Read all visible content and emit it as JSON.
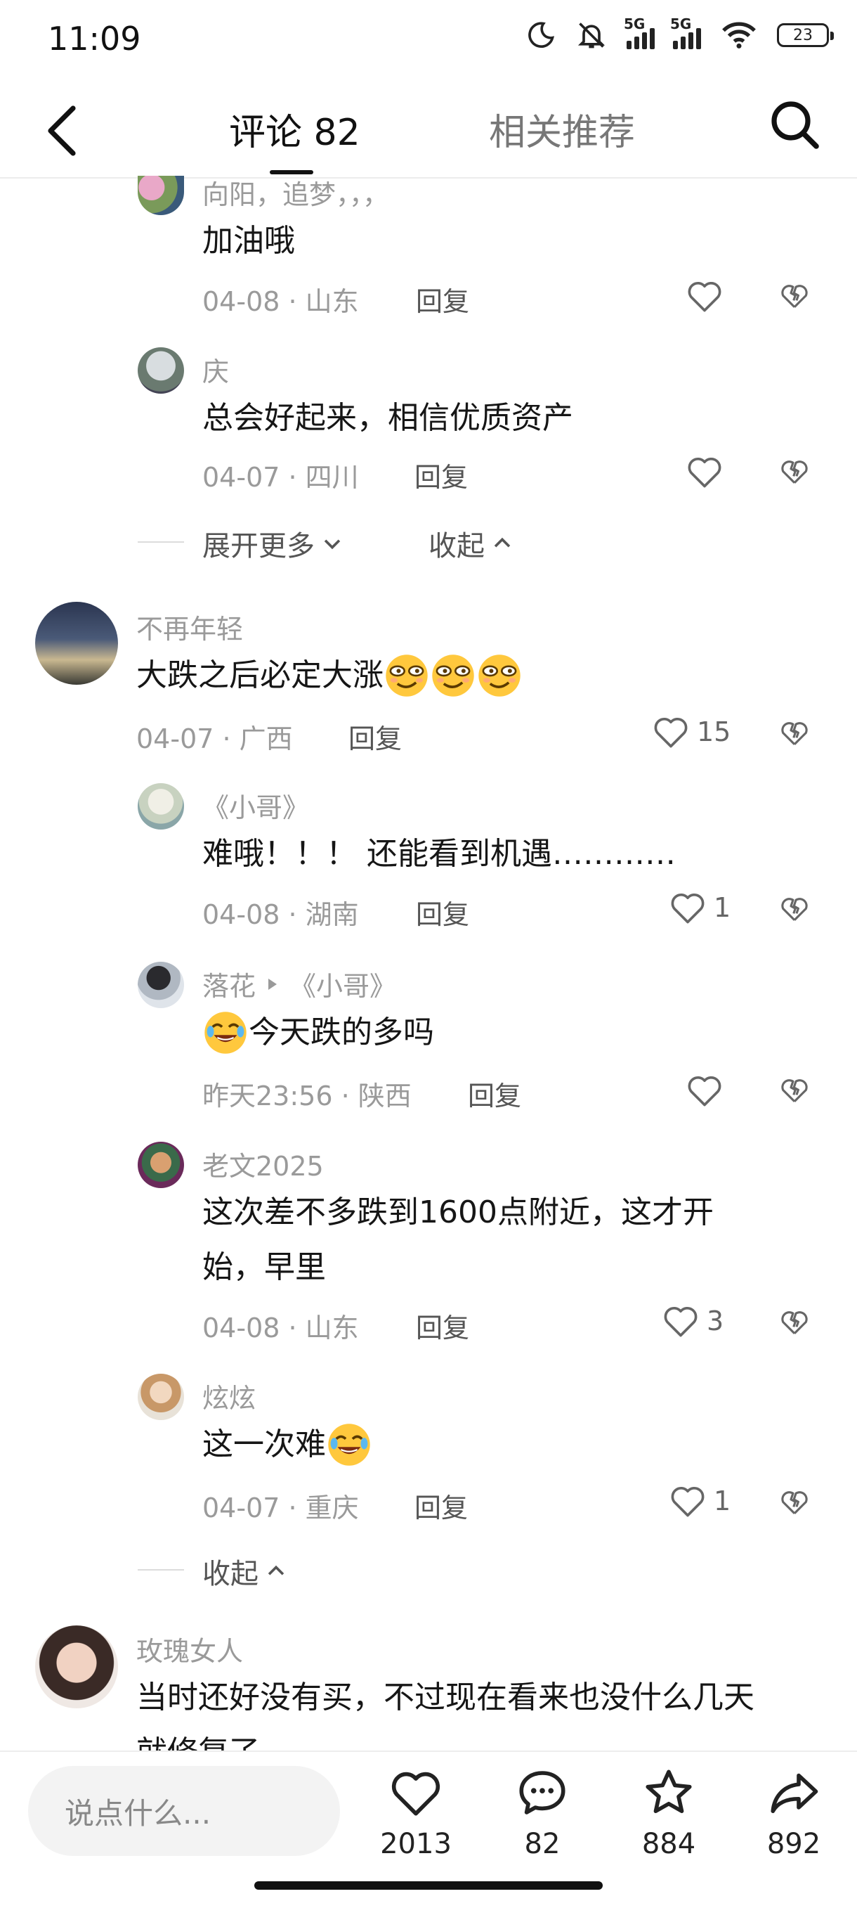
{
  "status_bar": {
    "time": "11:09",
    "battery": "23",
    "network1": "5G",
    "network2": "5G"
  },
  "header": {
    "tab_comments": "评论 82",
    "tab_related": "相关推荐"
  },
  "comments": [
    {
      "name": "向阳，追梦，，，",
      "text": "加油哦",
      "date": "04-08",
      "location": "山东",
      "reply": "回复",
      "likes": ""
    },
    {
      "name": "庆",
      "text": "总会好起来，相信优质资产",
      "date": "04-07",
      "location": "四川",
      "reply": "回复",
      "likes": ""
    },
    {
      "name": "不再年轻",
      "text": "大跌之后必定大涨",
      "date": "04-07",
      "location": "广西",
      "reply": "回复",
      "likes": "15"
    },
    {
      "name": "《小哥》",
      "text": "难哦！！！ 还能看到机遇…………",
      "date": "04-08",
      "location": "湖南",
      "reply": "回复",
      "likes": "1"
    },
    {
      "name": "落花",
      "reply_to": "《小哥》",
      "text": "今天跌的多吗",
      "date": "昨天23:56",
      "location": "陕西",
      "reply": "回复",
      "likes": ""
    },
    {
      "name": "老文2025",
      "text_line1": "这次差不多跌到1600点附近，这才开",
      "text_line2": "始，早里",
      "date": "04-08",
      "location": "山东",
      "reply": "回复",
      "likes": "3"
    },
    {
      "name": "炫炫",
      "text": "这一次难",
      "date": "04-07",
      "location": "重庆",
      "reply": "回复",
      "likes": "1"
    },
    {
      "name": "玫瑰女人",
      "text_line1": "当时还好没有买，不过现在看来也没什么几天",
      "text_line2": "就修复了"
    }
  ],
  "expand": {
    "more": "展开更多",
    "collapse": "收起"
  },
  "bottom_bar": {
    "placeholder": "说点什么...",
    "likes": "2013",
    "comments": "82",
    "favorites": "884",
    "shares": "892"
  },
  "icons": [
    "back-arrow-icon",
    "search-icon",
    "heart-icon",
    "broken-heart-icon",
    "chevron-down-icon",
    "chevron-up-icon",
    "comment-bubble-icon",
    "star-icon",
    "share-icon",
    "moon-icon",
    "mute-bell-icon",
    "signal-icon",
    "wifi-icon",
    "battery-icon"
  ]
}
